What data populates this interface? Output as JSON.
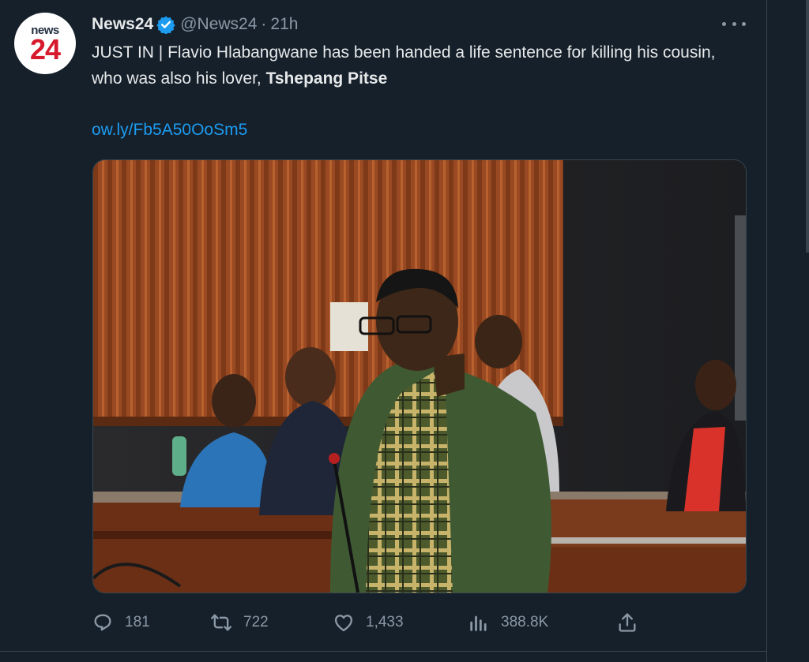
{
  "tweet": {
    "avatar": {
      "logo_top": "news",
      "logo_bottom": "24"
    },
    "display_name": "News24",
    "handle": "@News24",
    "separator": "·",
    "time": "21h",
    "text_main": "JUST IN | Flavio Hlabangwane has been handed a life sentence for killing his cousin, who was also his lover, ",
    "text_bold": "Tshepang Pitse",
    "link": "ow.ly/Fb5A50OoSm5"
  },
  "actions": {
    "replies": "181",
    "retweets": "722",
    "likes": "1,433",
    "views": "388.8K"
  },
  "colors": {
    "background": "#15202b",
    "text": "#e7e9ea",
    "muted": "#8b98a5",
    "link": "#1d9bf0",
    "verified": "#1d9bf0",
    "brand_red": "#d7192d"
  },
  "icons": [
    "verified-badge-icon",
    "more-icon",
    "reply-icon",
    "retweet-icon",
    "like-icon",
    "views-icon",
    "share-icon"
  ]
}
